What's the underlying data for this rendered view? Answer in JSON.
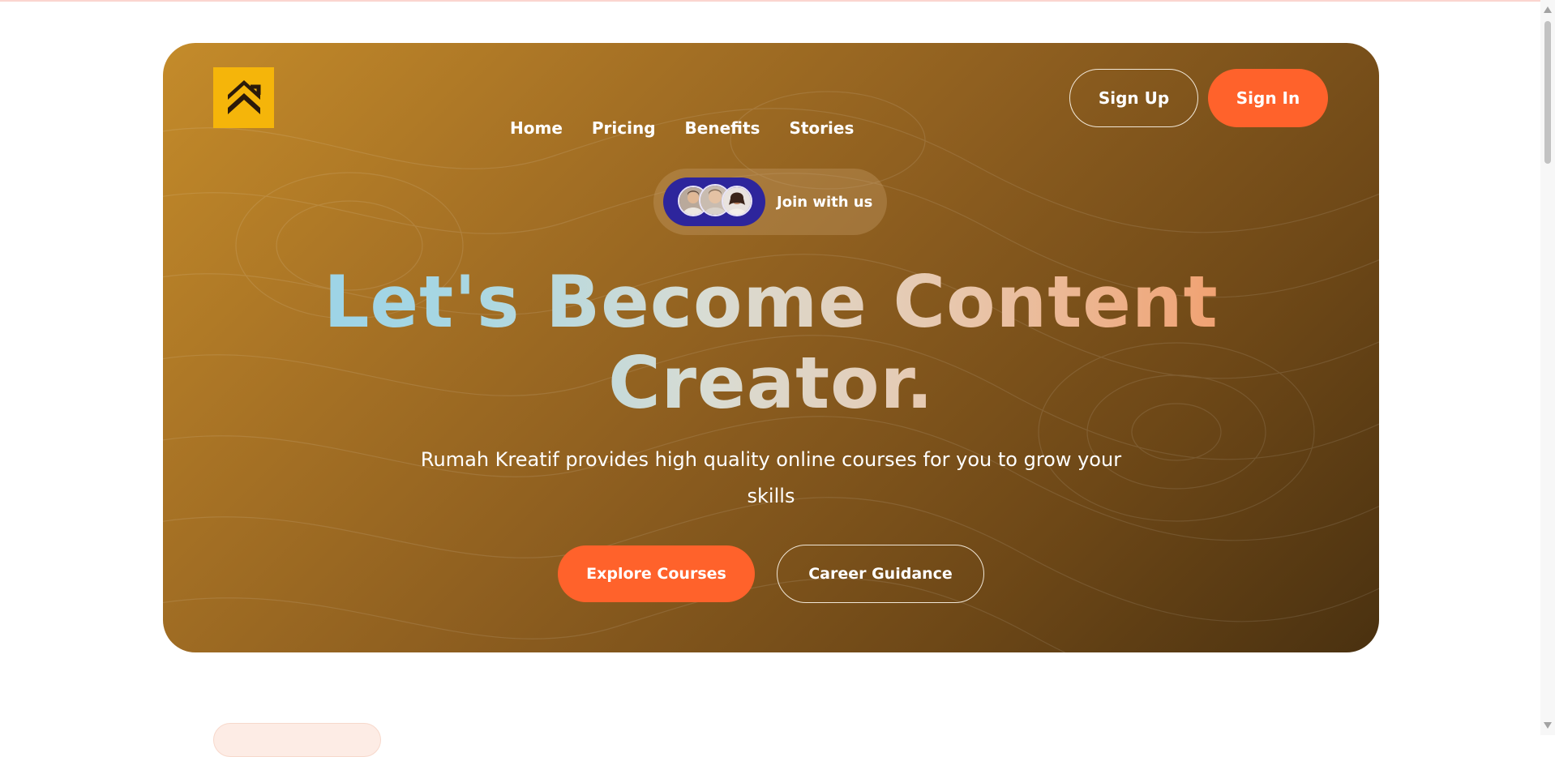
{
  "nav": {
    "items": [
      {
        "label": "Home"
      },
      {
        "label": "Pricing"
      },
      {
        "label": "Benefits"
      },
      {
        "label": "Stories"
      }
    ]
  },
  "auth": {
    "signup_label": "Sign Up",
    "signin_label": "Sign In"
  },
  "join": {
    "label": "Join with us"
  },
  "hero": {
    "headline_line1": "Let's Become Content",
    "headline_line2": "Creator.",
    "subtext": "Rumah Kreatif provides high quality online courses for you to grow your skills",
    "explore_label": "Explore Courses",
    "career_label": "Career Guidance"
  },
  "colors": {
    "accent": "#ff622b",
    "logo_bg": "#f5b50a",
    "avatar_group_bg": "#2d259c"
  },
  "icons": {
    "logo": "double-chevron-up-logo-icon"
  }
}
